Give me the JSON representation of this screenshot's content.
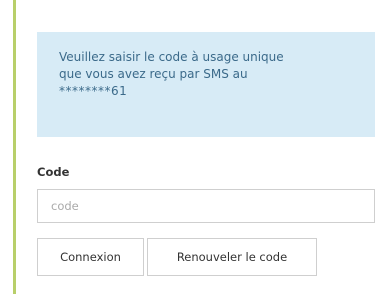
{
  "message": {
    "line1": "Veuillez saisir le code à usage unique",
    "line2": "que vous avez reçu par SMS au",
    "line3": "********61"
  },
  "form": {
    "code_label": "Code",
    "code_placeholder": "code",
    "code_value": ""
  },
  "buttons": {
    "login_label": "Connexion",
    "renew_label": "Renouveler le code"
  },
  "colors": {
    "accent_border": "#b8cf6a",
    "info_background": "#d7ebf6",
    "info_text": "#3b6a8a"
  }
}
